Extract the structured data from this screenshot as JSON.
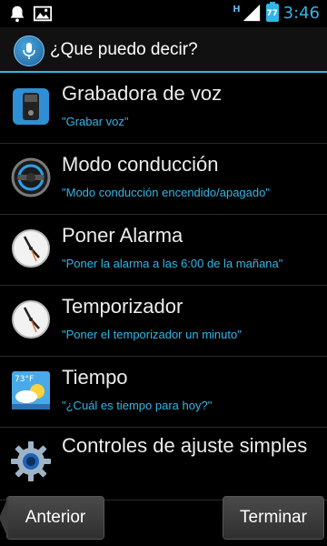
{
  "status_bar": {
    "time": "3:46",
    "battery": "77",
    "network": "H"
  },
  "action_bar": {
    "title": "¿Que puedo decir?",
    "icon": "microphone-icon"
  },
  "items": [
    {
      "title": "Grabadora de voz",
      "subtitle": "\"Grabar voz\"",
      "icon": "voice-recorder-icon"
    },
    {
      "title": "Modo conducción",
      "subtitle": "\"Modo conducción encendido/apagado\"",
      "icon": "steering-wheel-icon"
    },
    {
      "title": "Poner Alarma",
      "subtitle": "\"Poner la alarma a las 6:00 de la mañana\"",
      "icon": "clock-icon"
    },
    {
      "title": "Temporizador",
      "subtitle": "\"Poner el temporizador un minuto\"",
      "icon": "clock-icon"
    },
    {
      "title": "Tiempo",
      "subtitle": "\"¿Cuál es tiempo para hoy?\"",
      "icon": "weather-icon",
      "weather_temp": "73°F"
    },
    {
      "title": "Controles de ajuste simples",
      "subtitle": "",
      "icon": "settings-gear-icon"
    }
  ],
  "buttons": {
    "previous": "Anterior",
    "finish": "Terminar"
  },
  "colors": {
    "accent": "#33b5e5",
    "background": "#000000",
    "button": "#3a3a3a"
  }
}
